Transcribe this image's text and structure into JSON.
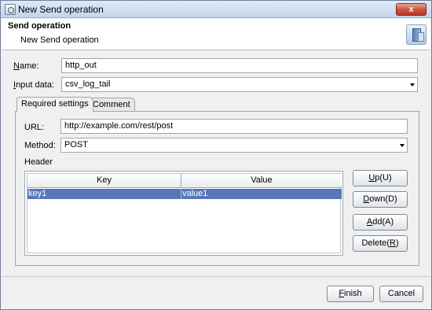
{
  "window": {
    "title": "New Send operation",
    "close_label": "x"
  },
  "header": {
    "title": "Send operation",
    "description": "New Send operation"
  },
  "form": {
    "name_label_key": "N",
    "name_label_rest": "ame:",
    "name_value": "http_out",
    "input_label_key": "I",
    "input_label_rest": "nput data:",
    "input_value": "csv_log_tail"
  },
  "tabs": [
    {
      "label": "Required settings",
      "active": true
    },
    {
      "label": "Comment",
      "active": false
    }
  ],
  "required_settings": {
    "url_label": "URL:",
    "url_value": "http://example.com/rest/post",
    "method_label": "Method:",
    "method_value": "POST",
    "header_label": "Header",
    "columns": [
      "Key",
      "Value"
    ],
    "rows": [
      {
        "key": "key1",
        "value": "value1",
        "selected": true
      }
    ]
  },
  "side_buttons": {
    "up": {
      "key": "U",
      "rest": "p(U)"
    },
    "down": {
      "key": "D",
      "rest": "own(D)"
    },
    "add": {
      "key": "A",
      "rest": "dd(A)"
    },
    "delete": {
      "pre": "Delete(",
      "key": "R",
      "post": ")"
    }
  },
  "footer": {
    "finish": {
      "key": "F",
      "rest": "inish"
    },
    "cancel": "Cancel"
  }
}
